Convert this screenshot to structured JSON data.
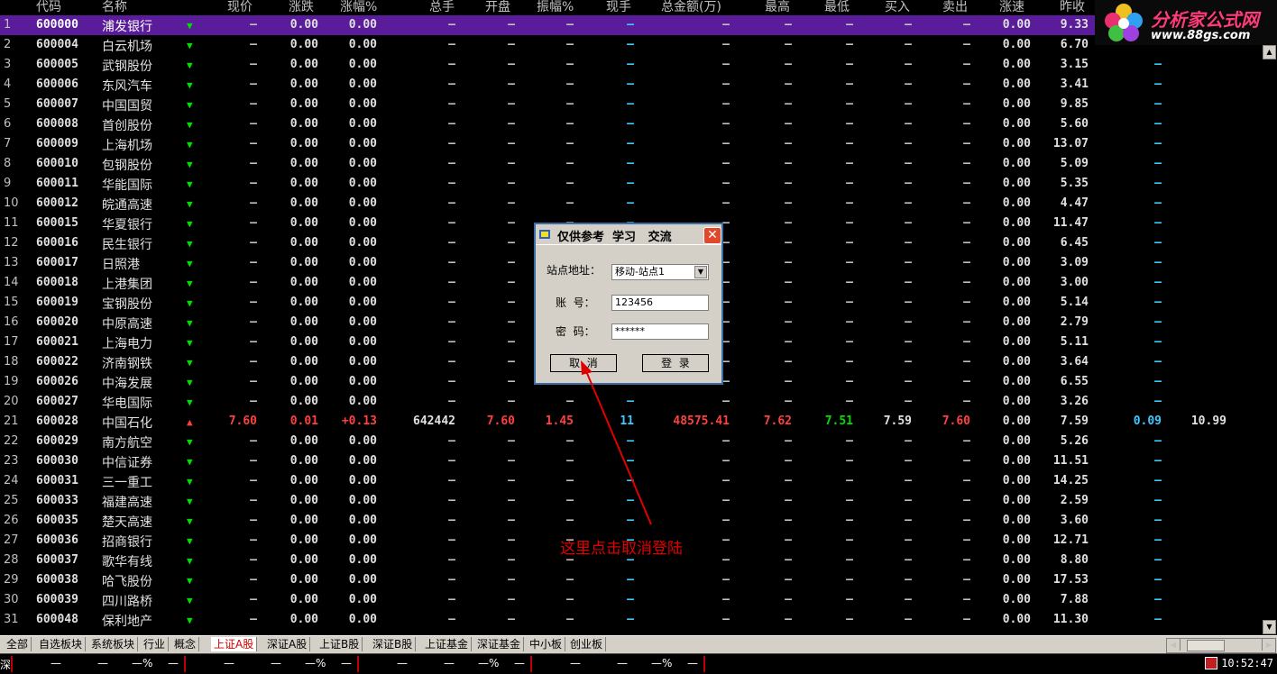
{
  "colors": {
    "red": "#ff4040",
    "green": "#00e000",
    "cyan": "#40c8ff",
    "select": "#5a1c9a",
    "annotation": "#e00000"
  },
  "headers": [
    "代码",
    "名称",
    "现价",
    "涨跌",
    "涨幅%",
    "总手",
    "开盘",
    "振幅%",
    "现手",
    "总金额(万)",
    "最高",
    "最低",
    "买入",
    "卖出",
    "涨速",
    "昨收"
  ],
  "rows": [
    {
      "n": "1",
      "code": "600000",
      "name": "浦发银行",
      "dir": "down",
      "close": "9.33"
    },
    {
      "n": "2",
      "code": "600004",
      "name": "白云机场",
      "dir": "down",
      "close": "6.70"
    },
    {
      "n": "3",
      "code": "600005",
      "name": "武钢股份",
      "dir": "down",
      "close": "3.15"
    },
    {
      "n": "4",
      "code": "600006",
      "name": "东风汽车",
      "dir": "down",
      "close": "3.41"
    },
    {
      "n": "5",
      "code": "600007",
      "name": "中国国贸",
      "dir": "down",
      "close": "9.85"
    },
    {
      "n": "6",
      "code": "600008",
      "name": "首创股份",
      "dir": "down",
      "close": "5.60"
    },
    {
      "n": "7",
      "code": "600009",
      "name": "上海机场",
      "dir": "down",
      "close": "13.07"
    },
    {
      "n": "8",
      "code": "600010",
      "name": "包钢股份",
      "dir": "down",
      "close": "5.09"
    },
    {
      "n": "9",
      "code": "600011",
      "name": "华能国际",
      "dir": "down",
      "close": "5.35"
    },
    {
      "n": "10",
      "code": "600012",
      "name": "皖通高速",
      "dir": "down",
      "close": "4.47"
    },
    {
      "n": "11",
      "code": "600015",
      "name": "华夏银行",
      "dir": "down",
      "close": "11.47"
    },
    {
      "n": "12",
      "code": "600016",
      "name": "民生银行",
      "dir": "down",
      "close": "6.45"
    },
    {
      "n": "13",
      "code": "600017",
      "name": "日照港",
      "dir": "down",
      "close": "3.09"
    },
    {
      "n": "14",
      "code": "600018",
      "name": "上港集团",
      "dir": "down",
      "close": "3.00"
    },
    {
      "n": "15",
      "code": "600019",
      "name": "宝钢股份",
      "dir": "down",
      "close": "5.14"
    },
    {
      "n": "16",
      "code": "600020",
      "name": "中原高速",
      "dir": "down",
      "close": "2.79"
    },
    {
      "n": "17",
      "code": "600021",
      "name": "上海电力",
      "dir": "down",
      "close": "5.11"
    },
    {
      "n": "18",
      "code": "600022",
      "name": "济南钢铁",
      "dir": "down",
      "close": "3.64"
    },
    {
      "n": "19",
      "code": "600026",
      "name": "中海发展",
      "dir": "down",
      "close": "6.55"
    },
    {
      "n": "20",
      "code": "600027",
      "name": "华电国际",
      "dir": "down",
      "close": "3.26"
    },
    {
      "n": "21",
      "code": "600028",
      "name": "中国石化",
      "dir": "up",
      "close": "7.59",
      "price": "7.60",
      "chg": "0.01",
      "pct": "+0.13",
      "vol": "642442",
      "open": "7.60",
      "amp": "1.45",
      "cur": "11",
      "amt": "48575.41",
      "high": "7.62",
      "low": "7.51",
      "bid": "7.59",
      "ask": "7.60",
      "x1": "0.09",
      "x2": "10.99"
    },
    {
      "n": "22",
      "code": "600029",
      "name": "南方航空",
      "dir": "down",
      "close": "5.26"
    },
    {
      "n": "23",
      "code": "600030",
      "name": "中信证券",
      "dir": "down",
      "close": "11.51"
    },
    {
      "n": "24",
      "code": "600031",
      "name": "三一重工",
      "dir": "down",
      "close": "14.25"
    },
    {
      "n": "25",
      "code": "600033",
      "name": "福建高速",
      "dir": "down",
      "close": "2.59"
    },
    {
      "n": "26",
      "code": "600035",
      "name": "楚天高速",
      "dir": "down",
      "close": "3.60"
    },
    {
      "n": "27",
      "code": "600036",
      "name": "招商银行",
      "dir": "down",
      "close": "12.71"
    },
    {
      "n": "28",
      "code": "600037",
      "name": "歌华有线",
      "dir": "down",
      "close": "8.80"
    },
    {
      "n": "29",
      "code": "600038",
      "name": "哈飞股份",
      "dir": "down",
      "close": "17.53"
    },
    {
      "n": "30",
      "code": "600039",
      "name": "四川路桥",
      "dir": "down",
      "close": "7.88"
    },
    {
      "n": "31",
      "code": "600048",
      "name": "保利地产",
      "dir": "down",
      "close": "11.30"
    }
  ],
  "dash": "—",
  "zero": "0.00",
  "logo": {
    "title": "分析家公式网",
    "url": "www.88gs.com"
  },
  "tabs": [
    "全部",
    "自选板块",
    "系统板块",
    "行业",
    "概念",
    "上证A股",
    "深证A股",
    "上证B股",
    "深证B股",
    "上证基金",
    "深证基金",
    "中小板",
    "创业板"
  ],
  "active_tab": 5,
  "status": {
    "seg_text": "—",
    "pct": "—%",
    "clock": "10:52:47",
    "left": "深"
  },
  "dialog": {
    "title": "仅供参考  学习   交流",
    "site_label": "站点地址：",
    "site_value": "移动-站点1",
    "account_label": "账  号：",
    "account_value": "123456",
    "password_label": "密  码：",
    "password_value": "******",
    "cancel": "取  消",
    "login": "登  录"
  },
  "annotation": "这里点击取消登陆"
}
